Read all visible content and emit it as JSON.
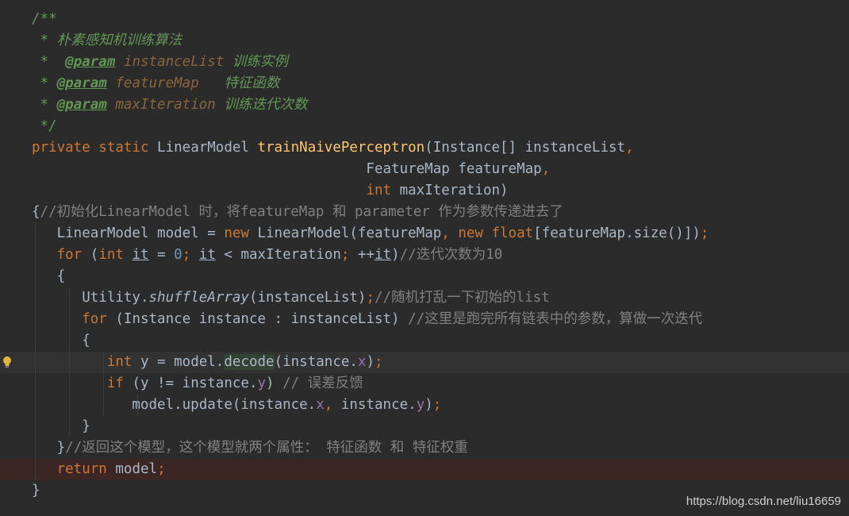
{
  "editor": {
    "lines": [
      [
        {
          "t": "/**",
          "c": "doc"
        }
      ],
      [
        {
          "t": " * 朴素感知机训练算法",
          "c": "doc"
        }
      ],
      [
        {
          "t": " *  ",
          "c": "doc"
        },
        {
          "t": "@param",
          "c": "doctag"
        },
        {
          "t": " ",
          "c": "doc"
        },
        {
          "t": "instanceList",
          "c": "docparam"
        },
        {
          "t": " 训练实例",
          "c": "doc"
        }
      ],
      [
        {
          "t": " * ",
          "c": "doc"
        },
        {
          "t": "@param",
          "c": "doctag"
        },
        {
          "t": " ",
          "c": "doc"
        },
        {
          "t": "featureMap",
          "c": "docparam"
        },
        {
          "t": "   特征函数",
          "c": "doc"
        }
      ],
      [
        {
          "t": " * ",
          "c": "doc"
        },
        {
          "t": "@param",
          "c": "doctag"
        },
        {
          "t": " ",
          "c": "doc"
        },
        {
          "t": "maxIteration",
          "c": "docparam"
        },
        {
          "t": " 训练迭代次数",
          "c": "doc"
        }
      ],
      [
        {
          "t": " */",
          "c": "doc"
        }
      ],
      [
        {
          "t": "private static ",
          "c": "kw"
        },
        {
          "t": "LinearModel ",
          "c": ""
        },
        {
          "t": "trainNaivePerceptron",
          "c": "fn"
        },
        {
          "t": "(Instance[] instanceList",
          "c": ""
        },
        {
          "t": ",",
          "c": "kw"
        }
      ],
      [
        {
          "t": "                                        FeatureMap featureMap",
          "c": ""
        },
        {
          "t": ",",
          "c": "kw"
        }
      ],
      [
        {
          "t": "                                        ",
          "c": ""
        },
        {
          "t": "int ",
          "c": "kw"
        },
        {
          "t": "maxIteration)",
          "c": ""
        }
      ],
      [
        {
          "t": "{",
          "c": ""
        },
        {
          "t": "//初始化LinearModel 时，将featureMap 和 parameter 作为参数传递进去了",
          "c": "cm"
        }
      ],
      [
        {
          "t": "   LinearModel model = ",
          "c": ""
        },
        {
          "t": "new ",
          "c": "kw"
        },
        {
          "t": "LinearModel(featureMap",
          "c": ""
        },
        {
          "t": ", ",
          "c": "kw"
        },
        {
          "t": "new float",
          "c": "kw"
        },
        {
          "t": "[featureMap.size()])",
          "c": ""
        },
        {
          "t": ";",
          "c": "kw"
        }
      ],
      [
        {
          "t": "   ",
          "c": ""
        },
        {
          "t": "for ",
          "c": "kw"
        },
        {
          "t": "(",
          "c": ""
        },
        {
          "t": "int ",
          "c": "kw"
        },
        {
          "t": "it",
          "c": "ul"
        },
        {
          "t": " = ",
          "c": ""
        },
        {
          "t": "0",
          "c": "num"
        },
        {
          "t": "; ",
          "c": "kw"
        },
        {
          "t": "it",
          "c": "ul"
        },
        {
          "t": " < maxIteration",
          "c": ""
        },
        {
          "t": "; ",
          "c": "kw"
        },
        {
          "t": "++",
          "c": ""
        },
        {
          "t": "it",
          "c": "ul"
        },
        {
          "t": ")",
          "c": ""
        },
        {
          "t": "//迭代次数为10",
          "c": "cm"
        }
      ],
      [
        {
          "t": "   {",
          "c": ""
        }
      ],
      [
        {
          "t": "      Utility.",
          "c": ""
        },
        {
          "t": "shuffleArray",
          "c": "static-call"
        },
        {
          "t": "(instanceList)",
          "c": ""
        },
        {
          "t": ";",
          "c": "kw"
        },
        {
          "t": "//随机打乱一下初始的list",
          "c": "cm"
        }
      ],
      [
        {
          "t": "      ",
          "c": ""
        },
        {
          "t": "for ",
          "c": "kw"
        },
        {
          "t": "(Instance instance : instanceList) ",
          "c": ""
        },
        {
          "t": "//这里是跑完所有链表中的参数，算做一次迭代",
          "c": "cm"
        }
      ],
      [
        {
          "t": "      {",
          "c": ""
        }
      ],
      [
        {
          "t": "         ",
          "c": ""
        },
        {
          "t": "int ",
          "c": "kw"
        },
        {
          "t": "y = model.",
          "c": ""
        },
        {
          "t": "decode",
          "c": "decode-hl"
        },
        {
          "t": "(instance.",
          "c": ""
        },
        {
          "t": "x",
          "c": "field"
        },
        {
          "t": ")",
          "c": ""
        },
        {
          "t": ";",
          "c": "kw"
        }
      ],
      [
        {
          "t": "         ",
          "c": ""
        },
        {
          "t": "if ",
          "c": "kw"
        },
        {
          "t": "(y != instance.",
          "c": ""
        },
        {
          "t": "y",
          "c": "field"
        },
        {
          "t": ") ",
          "c": ""
        },
        {
          "t": "// 误差反馈",
          "c": "cm"
        }
      ],
      [
        {
          "t": "            model.update(instance.",
          "c": ""
        },
        {
          "t": "x",
          "c": "field"
        },
        {
          "t": ", ",
          "c": "kw"
        },
        {
          "t": "instance.",
          "c": ""
        },
        {
          "t": "y",
          "c": "field"
        },
        {
          "t": ")",
          "c": ""
        },
        {
          "t": ";",
          "c": "kw"
        }
      ],
      [
        {
          "t": "      }",
          "c": ""
        }
      ],
      [
        {
          "t": "   }",
          "c": ""
        },
        {
          "t": "//返回这个模型，这个模型就两个属性： 特征函数 和 特征权重",
          "c": "cm"
        }
      ],
      [
        {
          "t": "   ",
          "c": ""
        },
        {
          "t": "return ",
          "c": "kw"
        },
        {
          "t": "model",
          "c": ""
        },
        {
          "t": ";",
          "c": "kw"
        }
      ],
      [
        {
          "t": "}",
          "c": ""
        }
      ]
    ]
  },
  "watermark": "https://blog.csdn.net/liu16659"
}
